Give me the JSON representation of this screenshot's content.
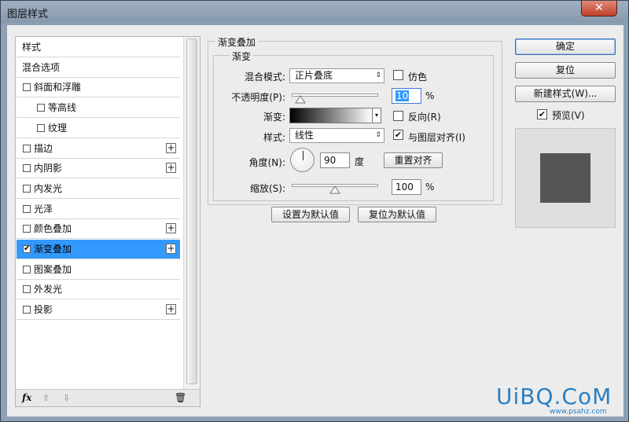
{
  "window": {
    "title": "图层样式",
    "close_glyph": "✕"
  },
  "style_list": {
    "items": [
      {
        "label": "样式"
      },
      {
        "label": "混合选项"
      },
      {
        "label": "斜面和浮雕",
        "checkbox": true,
        "checked": false
      },
      {
        "label": "等高线",
        "checkbox": true,
        "checked": false
      },
      {
        "label": "纹理",
        "checkbox": true,
        "checked": false
      },
      {
        "label": "描边",
        "checkbox": true,
        "checked": false,
        "plus": true
      },
      {
        "label": "内阴影",
        "checkbox": true,
        "checked": false,
        "plus": true
      },
      {
        "label": "内发光",
        "checkbox": true,
        "checked": false
      },
      {
        "label": "光泽",
        "checkbox": true,
        "checked": false
      },
      {
        "label": "颜色叠加",
        "checkbox": true,
        "checked": false,
        "plus": true
      },
      {
        "label": "渐变叠加",
        "checkbox": true,
        "checked": true,
        "plus": true,
        "selected": true
      },
      {
        "label": "图案叠加",
        "checkbox": true,
        "checked": false
      },
      {
        "label": "外发光",
        "checkbox": true,
        "checked": false
      },
      {
        "label": "投影",
        "checkbox": true,
        "checked": false,
        "plus": true
      }
    ],
    "footer": {
      "fx_label": "fx",
      "up_glyph": "⇧",
      "down_glyph": "⇩",
      "trash_glyph": "🗑"
    },
    "plus_glyph": "+",
    "check_glyph": "✔"
  },
  "gradient_overlay": {
    "section_title": "渐变叠加",
    "group_title": "渐变",
    "blend_mode_label": "混合模式:",
    "blend_mode_value": "正片叠底",
    "dither_label": "仿色",
    "dither_checked": false,
    "opacity_label": "不透明度(P):",
    "opacity_value": "10",
    "opacity_level": 0.1,
    "percent": "%",
    "gradient_label": "渐变:",
    "gradient_colors": [
      "#000000",
      "#ffffff"
    ],
    "reverse_label": "反向(R)",
    "reverse_checked": false,
    "style_label": "样式:",
    "style_value": "线性",
    "align_label": "与图层对齐(I)",
    "align_checked": true,
    "angle_label": "角度(N):",
    "angle_value": "90",
    "degree_label": "度",
    "reset_align_button": "重置对齐",
    "scale_label": "缩放(S):",
    "scale_value": "100",
    "scale_level": 0.5,
    "make_default_button": "设置为默认值",
    "reset_default_button": "复位为默认值",
    "select_arrows": "⇕",
    "dropdown_glyph": "▾"
  },
  "actions": {
    "ok_button": "确定",
    "reset_button": "复位",
    "new_style_button": "新建样式(W)...",
    "preview_label": "预览(V)",
    "preview_checked": true,
    "preview_swatch_color": "#555555"
  },
  "watermark": {
    "text": "UiBQ.CoM",
    "sub": "www.psahz.com"
  }
}
